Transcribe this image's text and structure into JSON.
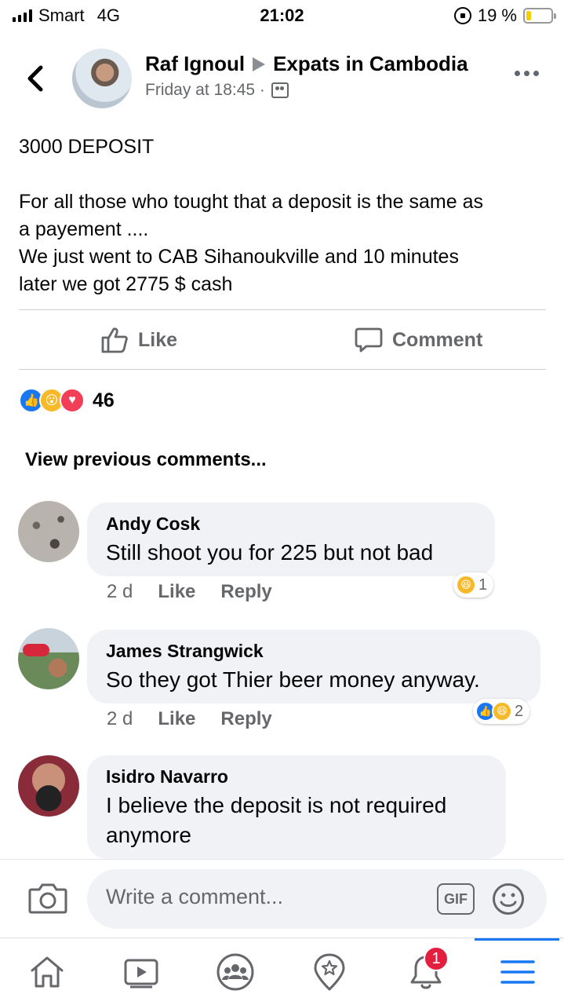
{
  "status_bar": {
    "carrier": "Smart",
    "network": "4G",
    "time": "21:02",
    "battery": "19 %",
    "battery_level": 0.19
  },
  "post": {
    "author": "Raf Ignoul",
    "group": "Expats in Cambodia",
    "timestamp": "Friday at 18:45 ·",
    "title": "3000 DEPOSIT",
    "body_lines": [
      "For all those who tought that a deposit is the same as",
      "a payement ....",
      "We just went to CAB Sihanoukville and 10 minutes",
      "later we got 2775 $ cash"
    ],
    "like_label": "Like",
    "comment_label": "Comment",
    "reaction_count": "46"
  },
  "view_previous": "View previous comments...",
  "comments": [
    {
      "name": "Andy Cosk",
      "text": "Still shoot you for 225 but not bad",
      "time": "2 d",
      "like": "Like",
      "reply": "Reply",
      "reaction_count": "1"
    },
    {
      "name": "James Strangwick",
      "text": "So they got Thier beer money anyway.",
      "time": "2 d",
      "like": "Like",
      "reply": "Reply",
      "reaction_count": "2"
    },
    {
      "name": "Isidro Navarro",
      "text_lines": [
        "I believe the deposit is not required",
        "anymore"
      ]
    }
  ],
  "composer": {
    "placeholder": "Write a comment...",
    "gif_label": "GIF"
  },
  "nav": {
    "notifications_badge": "1",
    "active": "menu"
  },
  "colors": {
    "accent": "#1877f2",
    "bubble": "#f0f2f5",
    "badge": "#e41e3f"
  }
}
